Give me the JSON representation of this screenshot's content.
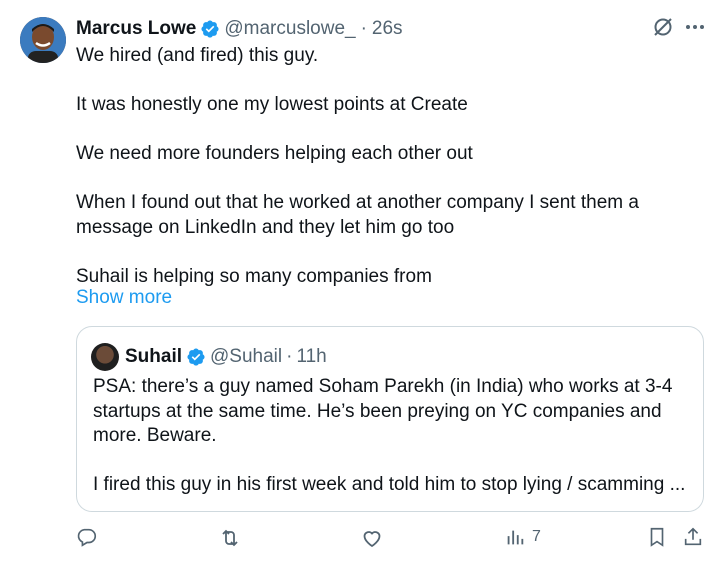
{
  "tweet": {
    "author": {
      "name": "Marcus Lowe",
      "handle": "@marcuslowe_",
      "time": "26s"
    },
    "separator": "·",
    "body": [
      "We hired (and fired) this guy.",
      "",
      "It was honestly one my lowest points at Create",
      "",
      "We need more founders helping each other out",
      "",
      "When I found out that he worked at another company I sent them a",
      "message on LinkedIn and they let him go too",
      "",
      "Suhail is helping so many companies from"
    ],
    "show_more": "Show more"
  },
  "quote": {
    "author": {
      "name": "Suhail",
      "handle": "@Suhail",
      "time": "11h"
    },
    "separator": "·",
    "body": [
      "PSA: there’s a guy named Soham Parekh (in India) who works at 3-4",
      "startups at the same time. He’s been preying on YC companies and",
      "more. Beware.",
      "",
      "I fired this guy in his first week and told him to stop lying / scamming ..."
    ]
  },
  "actions": {
    "views": "7"
  },
  "colors": {
    "accent": "#1d9bf0",
    "muted": "#536471",
    "text": "#0f1419",
    "border": "#cfd9de"
  },
  "icons": [
    "verified-badge-icon",
    "grok-slash-icon",
    "more-icon",
    "reply-icon",
    "retweet-icon",
    "like-icon",
    "views-icon",
    "bookmark-icon",
    "share-icon"
  ]
}
